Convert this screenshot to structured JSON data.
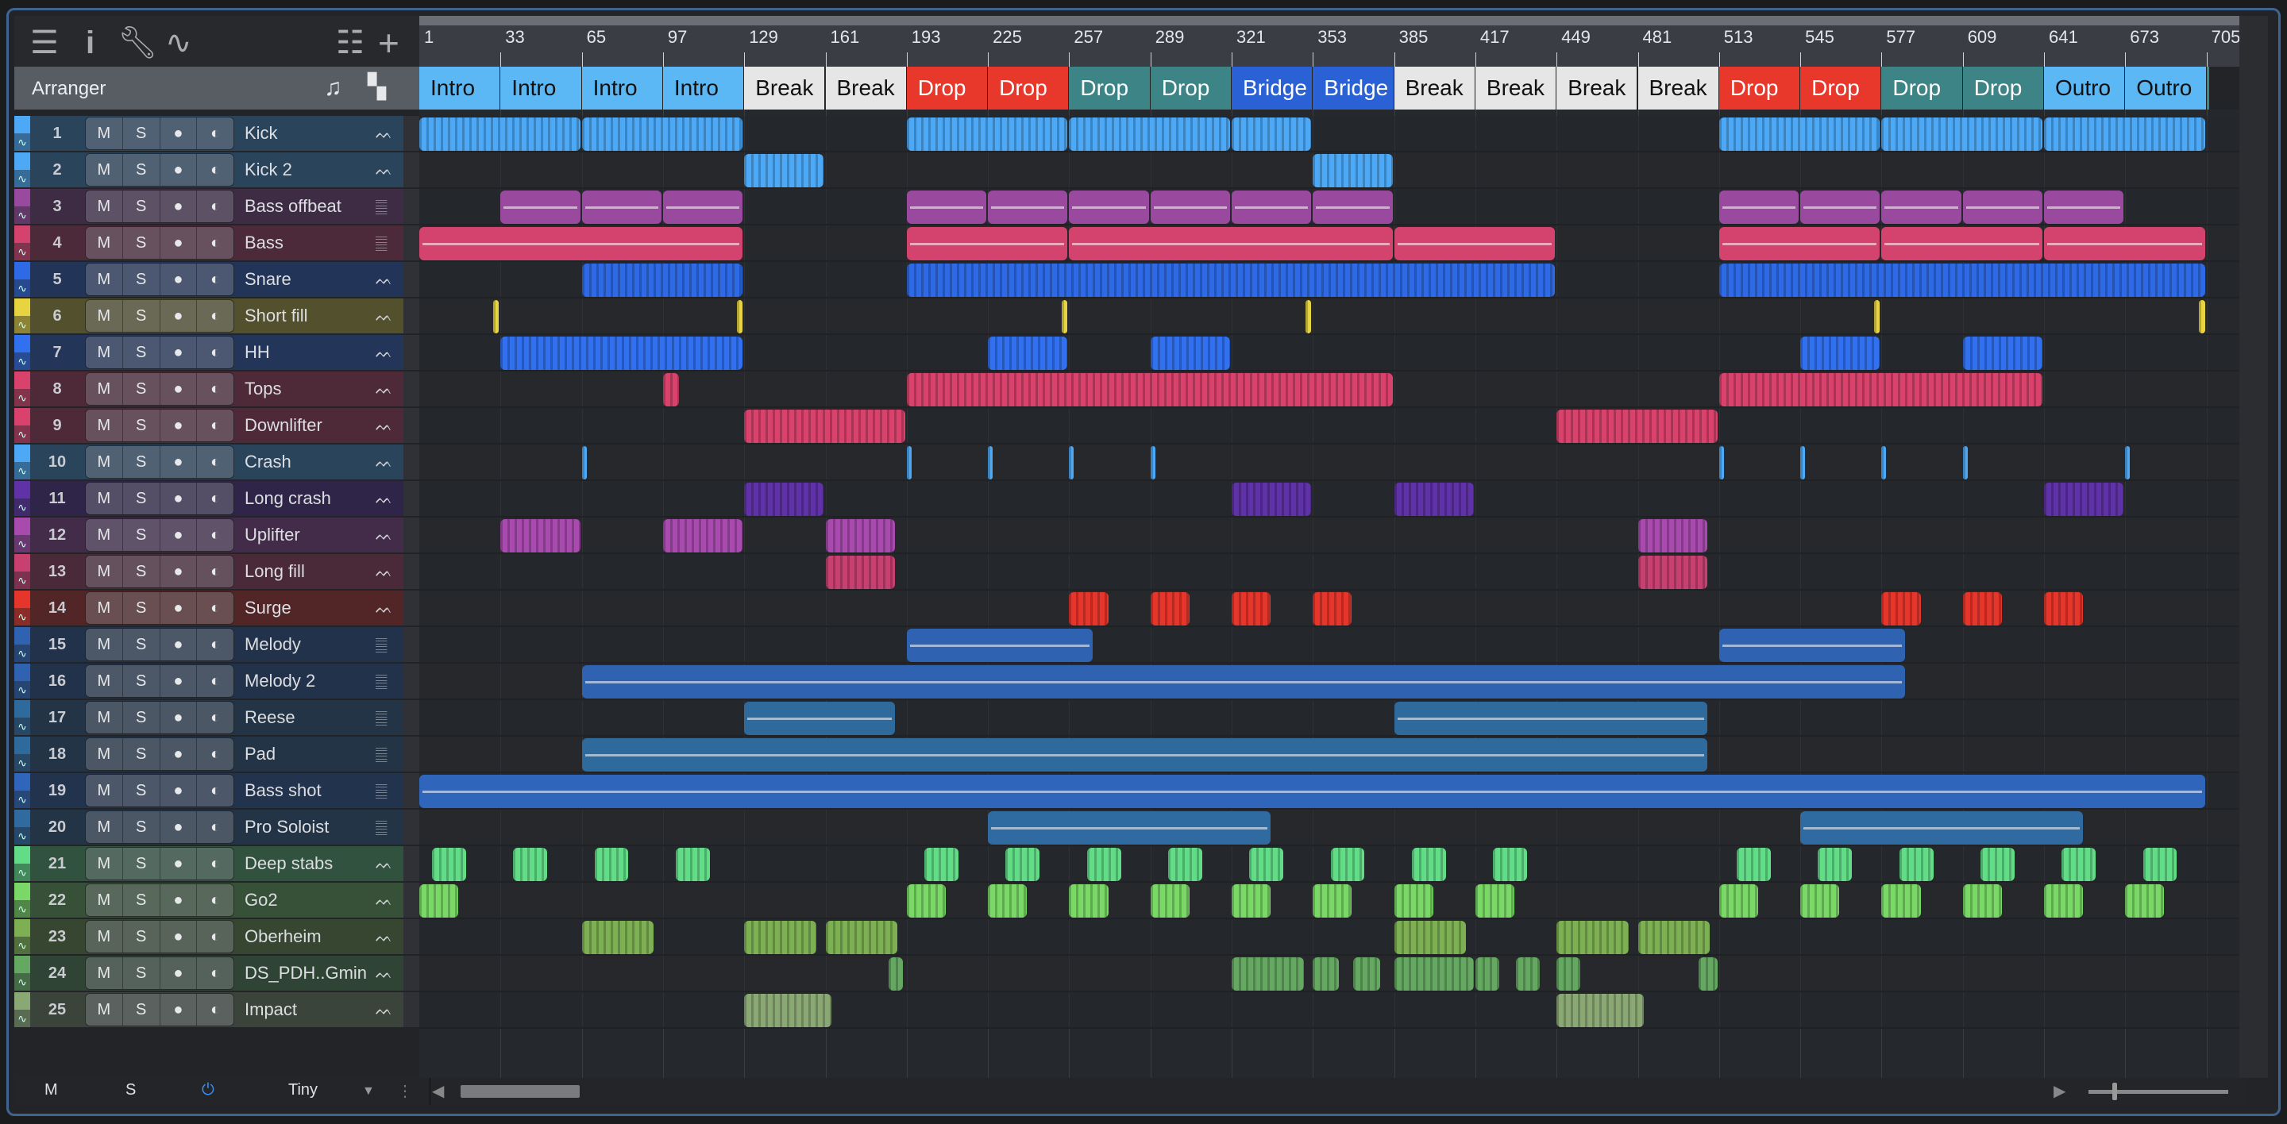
{
  "toolbar": {
    "icons": [
      "menu-icon",
      "info-icon",
      "wrench-icon",
      "automation-icon",
      "list-icon",
      "add-icon"
    ]
  },
  "arranger": {
    "label": "Arranger"
  },
  "ruler": {
    "bars": [
      "1",
      "33",
      "65",
      "97",
      "129",
      "161",
      "193",
      "225",
      "257",
      "289",
      "321",
      "353",
      "385",
      "417",
      "449",
      "481",
      "513",
      "545",
      "577",
      "609",
      "641",
      "673",
      "705"
    ]
  },
  "sections": [
    {
      "label": "Intro",
      "color": "#5bb8f5",
      "text": "#111"
    },
    {
      "label": "Intro",
      "color": "#5bb8f5",
      "text": "#111"
    },
    {
      "label": "Intro",
      "color": "#5bb8f5",
      "text": "#111"
    },
    {
      "label": "Intro",
      "color": "#5bb8f5",
      "text": "#111"
    },
    {
      "label": "Break",
      "color": "#e6e6e6",
      "text": "#111"
    },
    {
      "label": "Break",
      "color": "#e6e6e6",
      "text": "#111"
    },
    {
      "label": "Drop",
      "color": "#e8382c",
      "text": "#fff"
    },
    {
      "label": "Drop",
      "color": "#e8382c",
      "text": "#fff"
    },
    {
      "label": "Drop",
      "color": "#3d8487",
      "text": "#fff"
    },
    {
      "label": "Drop",
      "color": "#3d8487",
      "text": "#fff"
    },
    {
      "label": "Bridge",
      "color": "#2a62d6",
      "text": "#fff"
    },
    {
      "label": "Bridge",
      "color": "#2a62d6",
      "text": "#fff"
    },
    {
      "label": "Break",
      "color": "#e6e6e6",
      "text": "#111"
    },
    {
      "label": "Break",
      "color": "#e6e6e6",
      "text": "#111"
    },
    {
      "label": "Break",
      "color": "#e6e6e6",
      "text": "#111"
    },
    {
      "label": "Break",
      "color": "#e6e6e6",
      "text": "#111"
    },
    {
      "label": "Drop",
      "color": "#e8382c",
      "text": "#fff"
    },
    {
      "label": "Drop",
      "color": "#e8382c",
      "text": "#fff"
    },
    {
      "label": "Drop",
      "color": "#3d8487",
      "text": "#fff"
    },
    {
      "label": "Drop",
      "color": "#3d8487",
      "text": "#fff"
    },
    {
      "label": "Outro",
      "color": "#5bb8f5",
      "text": "#111"
    },
    {
      "label": "Outro",
      "color": "#5bb8f5",
      "text": "#111"
    },
    {
      "label": "Outro",
      "color": "#3f8a80",
      "text": "#fff"
    }
  ],
  "button_labels": {
    "mute": "M",
    "solo": "S",
    "record": "●",
    "monitor": "◐"
  },
  "tracks": [
    {
      "num": "1",
      "name": "Kick",
      "color": "#4da9f5",
      "type": "audio",
      "clips": [
        [
          1,
          64
        ],
        [
          65,
          64
        ],
        [
          193,
          64
        ],
        [
          257,
          64
        ],
        [
          321,
          32
        ],
        [
          513,
          64
        ],
        [
          577,
          64
        ],
        [
          641,
          64
        ]
      ]
    },
    {
      "num": "2",
      "name": "Kick 2",
      "color": "#4da9f5",
      "type": "audio",
      "clips": [
        [
          129,
          32
        ],
        [
          353,
          32
        ]
      ]
    },
    {
      "num": "3",
      "name": "Bass offbeat",
      "color": "#9a4a9e",
      "type": "midi",
      "clips": [
        [
          33,
          32
        ],
        [
          65,
          32
        ],
        [
          97,
          32
        ],
        [
          193,
          32
        ],
        [
          225,
          32
        ],
        [
          257,
          32
        ],
        [
          289,
          32
        ],
        [
          321,
          32
        ],
        [
          353,
          32
        ],
        [
          513,
          32
        ],
        [
          545,
          32
        ],
        [
          577,
          32
        ],
        [
          609,
          32
        ],
        [
          641,
          32
        ]
      ]
    },
    {
      "num": "4",
      "name": "Bass",
      "color": "#d4426e",
      "type": "midi",
      "clips": [
        [
          1,
          128
        ],
        [
          193,
          64
        ],
        [
          257,
          128
        ],
        [
          385,
          64
        ],
        [
          513,
          64
        ],
        [
          577,
          64
        ],
        [
          641,
          64
        ]
      ]
    },
    {
      "num": "5",
      "name": "Snare",
      "color": "#2f6ae6",
      "type": "audio",
      "clips": [
        [
          65,
          64
        ],
        [
          193,
          256
        ],
        [
          513,
          192
        ]
      ]
    },
    {
      "num": "6",
      "name": "Short fill",
      "color": "#e8d440",
      "type": "audio",
      "clips": [
        [
          30,
          3
        ],
        [
          126,
          3
        ],
        [
          254,
          3
        ],
        [
          350,
          3
        ],
        [
          574,
          3
        ],
        [
          702,
          3
        ]
      ]
    },
    {
      "num": "7",
      "name": "HH",
      "color": "#3170ee",
      "type": "audio",
      "clips": [
        [
          33,
          96
        ],
        [
          225,
          32
        ],
        [
          289,
          32
        ],
        [
          545,
          32
        ],
        [
          609,
          32
        ]
      ]
    },
    {
      "num": "8",
      "name": "Tops",
      "color": "#d8426c",
      "type": "audio",
      "clips": [
        [
          97,
          7
        ],
        [
          193,
          192
        ],
        [
          513,
          128
        ]
      ]
    },
    {
      "num": "9",
      "name": "Downlifter",
      "color": "#d8426c",
      "type": "audio",
      "clips": [
        [
          129,
          64
        ],
        [
          449,
          64
        ]
      ]
    },
    {
      "num": "10",
      "name": "Crash",
      "color": "#4da9f5",
      "type": "audio",
      "clips": [
        [
          65,
          2
        ],
        [
          193,
          2
        ],
        [
          225,
          2
        ],
        [
          257,
          2
        ],
        [
          289,
          2
        ],
        [
          513,
          2
        ],
        [
          545,
          2
        ],
        [
          577,
          2
        ],
        [
          609,
          2
        ],
        [
          673,
          2
        ]
      ]
    },
    {
      "num": "11",
      "name": "Long crash",
      "color": "#6032a8",
      "type": "audio",
      "clips": [
        [
          129,
          32
        ],
        [
          321,
          32
        ],
        [
          385,
          32
        ],
        [
          641,
          32
        ]
      ]
    },
    {
      "num": "12",
      "name": "Uplifter",
      "color": "#a84aae",
      "type": "audio",
      "clips": [
        [
          33,
          32
        ],
        [
          97,
          32
        ],
        [
          161,
          28
        ],
        [
          481,
          28
        ]
      ]
    },
    {
      "num": "13",
      "name": "Long fill",
      "color": "#c84070",
      "type": "audio",
      "clips": [
        [
          161,
          28
        ],
        [
          481,
          28
        ]
      ]
    },
    {
      "num": "14",
      "name": "Surge",
      "color": "#e6352a",
      "type": "audio",
      "clips": [
        [
          257,
          16
        ],
        [
          289,
          16
        ],
        [
          321,
          16
        ],
        [
          353,
          16
        ],
        [
          577,
          16
        ],
        [
          609,
          16
        ],
        [
          641,
          16
        ]
      ]
    },
    {
      "num": "15",
      "name": "Melody",
      "color": "#2f62b0",
      "type": "midi",
      "clips": [
        [
          193,
          74
        ],
        [
          513,
          74
        ]
      ]
    },
    {
      "num": "16",
      "name": "Melody 2",
      "color": "#2f62b0",
      "type": "midi",
      "clips": [
        [
          65,
          522
        ]
      ]
    },
    {
      "num": "17",
      "name": "Reese",
      "color": "#2f6a9c",
      "type": "midi",
      "clips": [
        [
          129,
          60
        ],
        [
          385,
          124
        ]
      ]
    },
    {
      "num": "18",
      "name": "Pad",
      "color": "#2f6a9c",
      "type": "midi",
      "clips": [
        [
          65,
          444
        ]
      ]
    },
    {
      "num": "19",
      "name": "Bass shot",
      "color": "#2f66bc",
      "type": "midi",
      "clips": [
        [
          1,
          704
        ]
      ]
    },
    {
      "num": "20",
      "name": "Pro Soloist",
      "color": "#2f6aa0",
      "type": "midi",
      "clips": [
        [
          225,
          112
        ],
        [
          545,
          112
        ]
      ]
    },
    {
      "num": "21",
      "name": "Deep stabs",
      "color": "#62dc86",
      "type": "audio",
      "clips": [
        [
          6,
          14
        ],
        [
          38,
          14
        ],
        [
          70,
          14
        ],
        [
          102,
          14
        ],
        [
          200,
          14
        ],
        [
          232,
          14
        ],
        [
          264,
          14
        ],
        [
          296,
          14
        ],
        [
          328,
          14
        ],
        [
          360,
          14
        ],
        [
          392,
          14
        ],
        [
          424,
          14
        ],
        [
          520,
          14
        ],
        [
          552,
          14
        ],
        [
          584,
          14
        ],
        [
          616,
          14
        ],
        [
          648,
          14
        ],
        [
          680,
          14
        ]
      ]
    },
    {
      "num": "22",
      "name": "Go2",
      "color": "#7ad866",
      "type": "audio",
      "clips": [
        [
          1,
          16
        ],
        [
          193,
          16
        ],
        [
          225,
          16
        ],
        [
          257,
          16
        ],
        [
          289,
          16
        ],
        [
          321,
          16
        ],
        [
          353,
          16
        ],
        [
          385,
          16
        ],
        [
          417,
          16
        ],
        [
          513,
          16
        ],
        [
          545,
          16
        ],
        [
          577,
          16
        ],
        [
          609,
          16
        ],
        [
          641,
          16
        ],
        [
          673,
          16
        ]
      ]
    },
    {
      "num": "23",
      "name": "Oberheim",
      "color": "#7cb052",
      "type": "audio",
      "clips": [
        [
          65,
          29
        ],
        [
          129,
          29
        ],
        [
          161,
          29
        ],
        [
          385,
          29
        ],
        [
          449,
          29
        ],
        [
          481,
          29
        ]
      ]
    },
    {
      "num": "24",
      "name": "DS_PDH..Gmin",
      "color": "#64a862",
      "type": "audio",
      "clips": [
        [
          186,
          6
        ],
        [
          321,
          29
        ],
        [
          353,
          11
        ],
        [
          369,
          11
        ],
        [
          385,
          32
        ],
        [
          417,
          10
        ],
        [
          433,
          10
        ],
        [
          449,
          10
        ],
        [
          505,
          8
        ]
      ]
    },
    {
      "num": "25",
      "name": "Impact",
      "color": "#8aa874",
      "type": "audio",
      "clips": [
        [
          129,
          35
        ],
        [
          449,
          35
        ]
      ]
    }
  ],
  "bottom": {
    "mute": "M",
    "solo": "S",
    "size": "Tiny"
  }
}
